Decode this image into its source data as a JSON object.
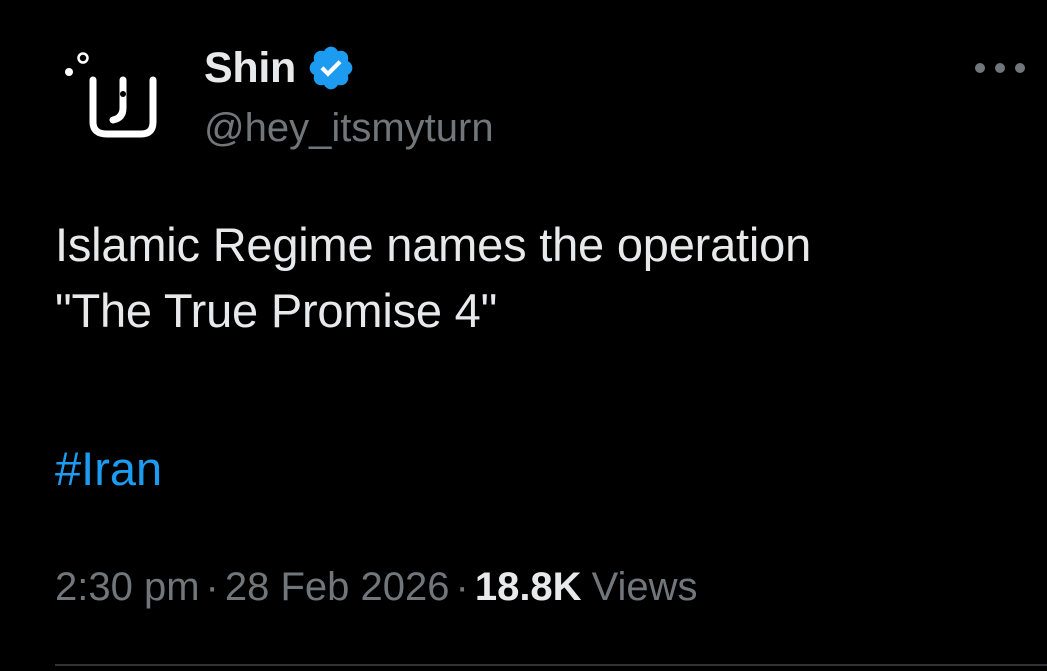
{
  "author": {
    "display_name": "Shin",
    "handle": "@hey_itsmyturn",
    "verified": true,
    "avatar_glyph": "ש"
  },
  "tweet": {
    "text_lines": [
      "Islamic Regime names the operation",
      "\"The True Promise 4\""
    ],
    "hashtag": "#Iran"
  },
  "meta": {
    "time": "2:30 pm",
    "separator": "·",
    "date": "28 Feb 2026",
    "views_count": "18.8K",
    "views_label": "Views"
  },
  "colors": {
    "background": "#000000",
    "text_primary": "#e7e9ea",
    "text_secondary": "#71767b",
    "link": "#1d9bf0",
    "verified_badge": "#1d9bf0"
  },
  "icons": {
    "verified": "verified-badge-icon",
    "more": "more-options-icon"
  }
}
